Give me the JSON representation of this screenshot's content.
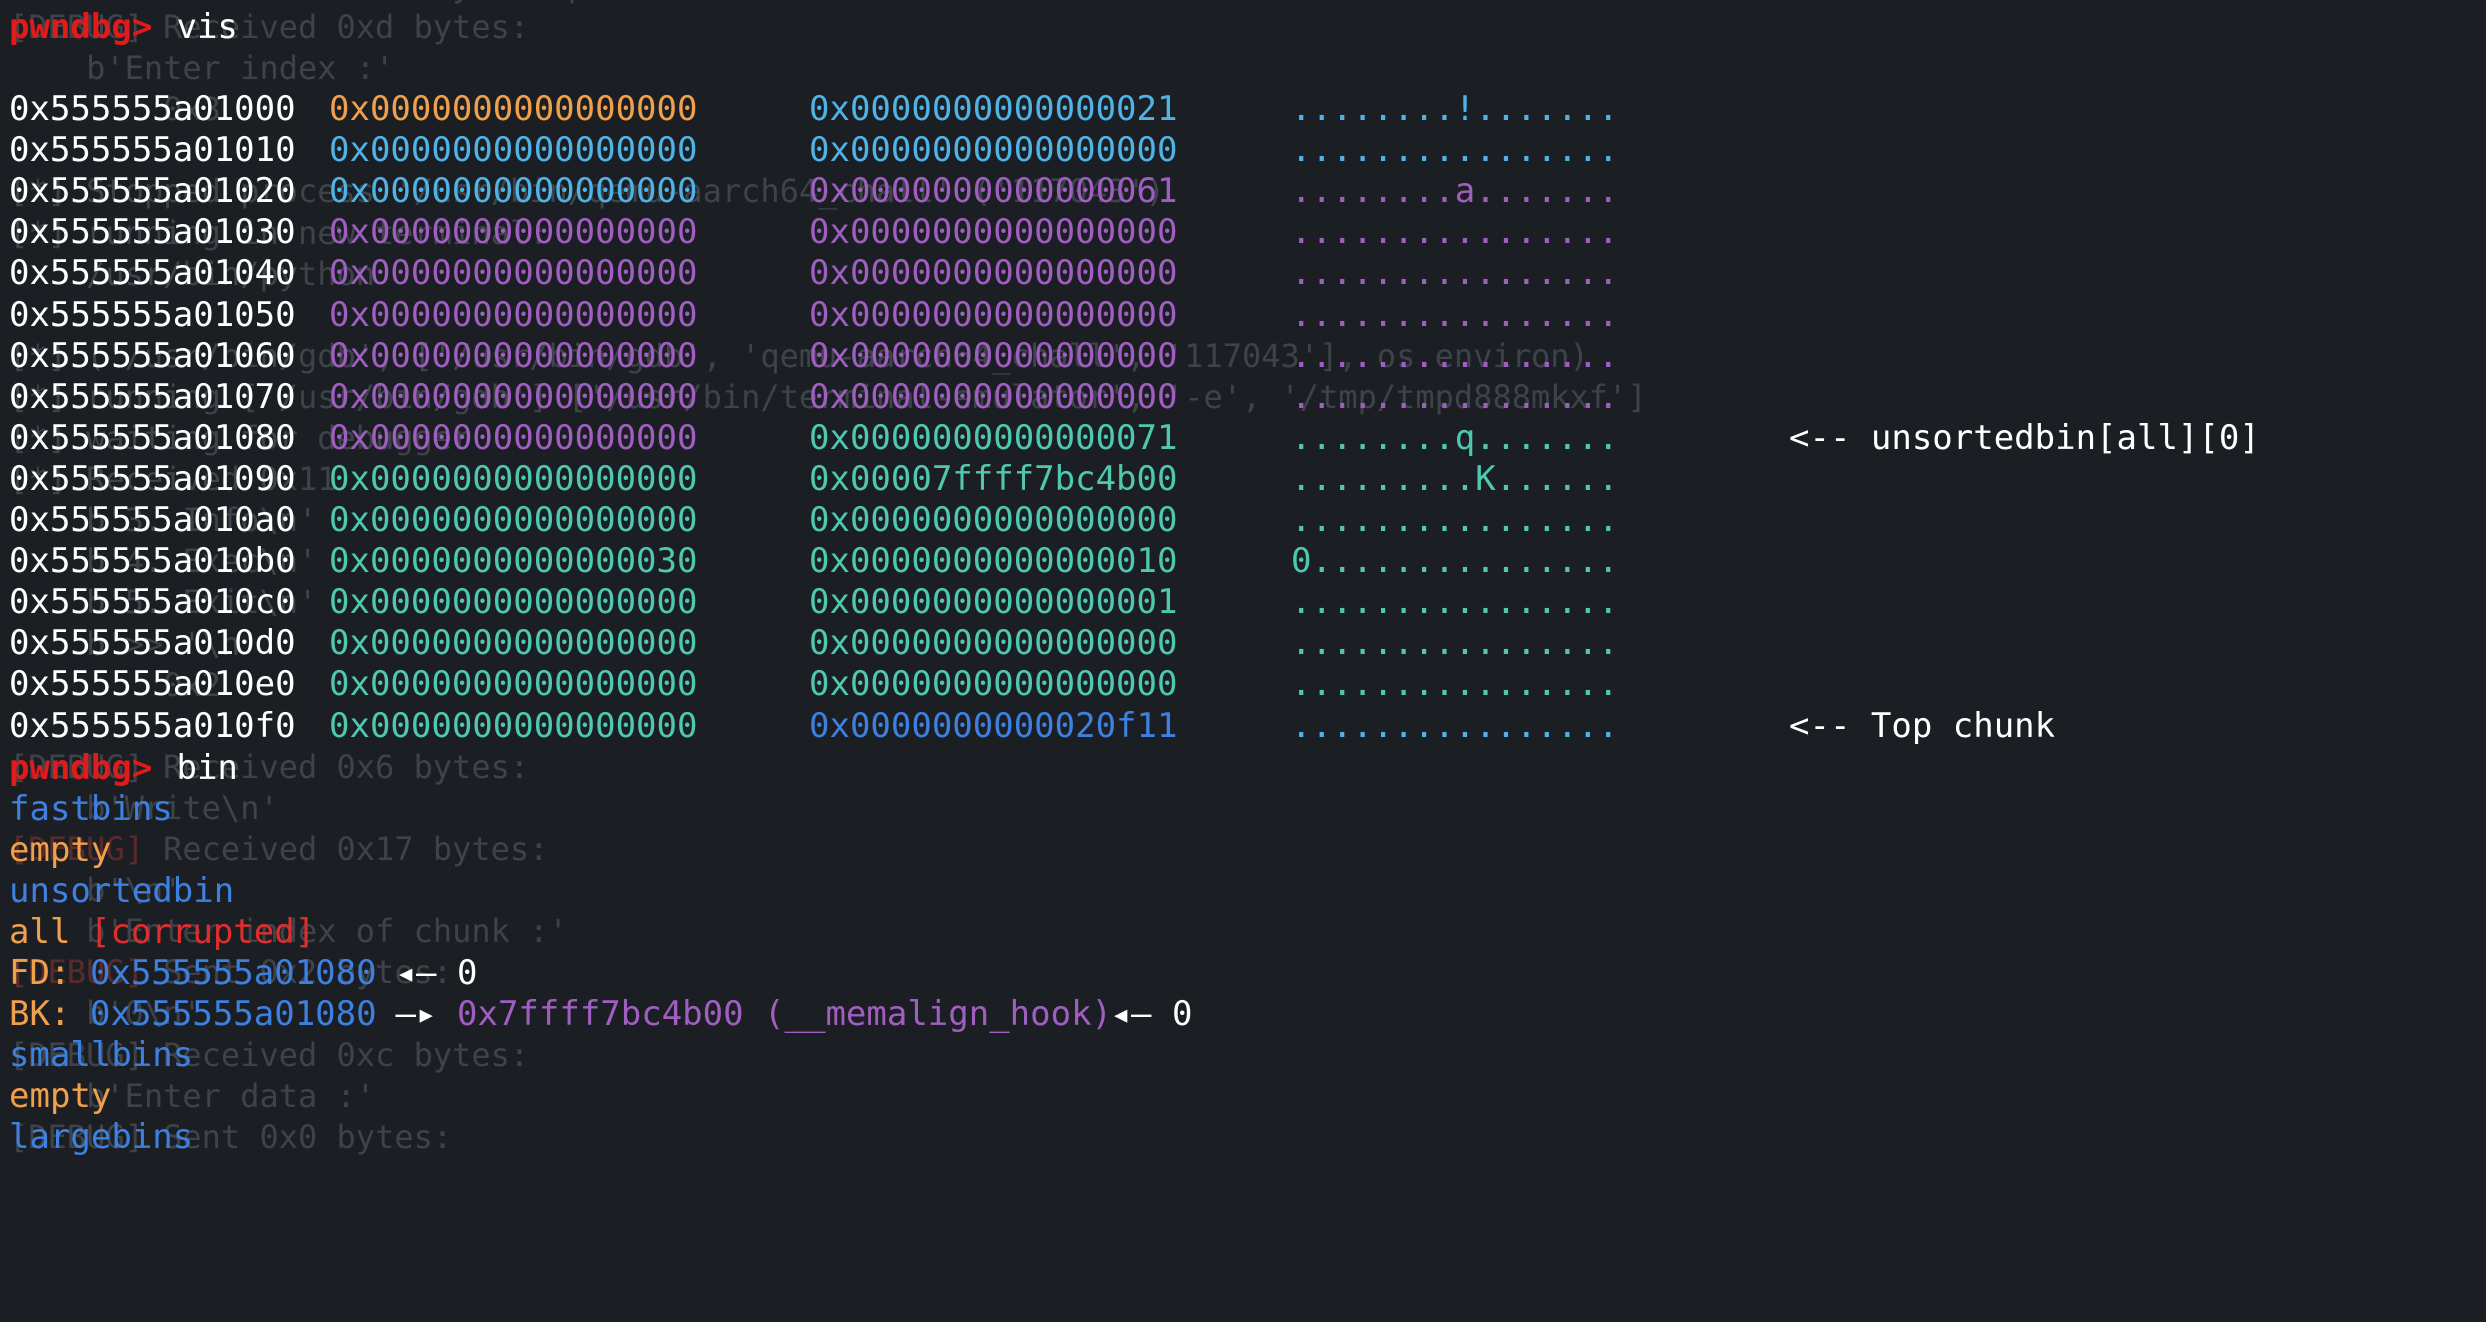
{
  "colors": {
    "background": "#1b1f24",
    "prompt": "#e01b1b",
    "address": "#ffffff",
    "orange": "#f0a04b",
    "sky": "#4fb3e6",
    "purple": "#a05fc0",
    "teal": "#4ec9b0",
    "blue": "#3d80e0",
    "ghost": "#3d4349"
  },
  "background_lines": [
    {
      "row": -1,
      "text": "                  ...ady ... p...",
      "red": false
    },
    {
      "row": 0,
      "text": "[DEBUG] Received 0xd bytes:",
      "red": false
    },
    {
      "row": 1,
      "text": "    b'Enter index :'",
      "red": false
    },
    {
      "row": 2,
      "text": "        0x3",
      "red": false
    },
    {
      "row": 4,
      "text": "[*] Stopped process '/usr/bin/qemu-aarch64_chall' ('117043')",
      "red": false
    },
    {
      "row": 5,
      "text": "[*] running in new terminal:",
      "red": false
    },
    {
      "row": 6,
      "text": "    /usr/bin/python",
      "red": false
    },
    {
      "row": 8,
      "text": "[*] ('/usr/bin/gdb', ['/usr/bin/gdb', 'qemu-aarch64_chall', '117043'], os.environ)",
      "red": false
    },
    {
      "row": 9,
      "text": "[*] running ['/usr/bin/gdb'] ['/usr/bin/terminal-emulator', '-e', '/tmp/tmpd888mkxf']",
      "red": false
    },
    {
      "row": 10,
      "text": "[*] waiting for debugger",
      "red": false
    },
    {
      "row": 11,
      "text": "[*] Received 0x11",
      "red": false
    },
    {
      "row": 12,
      "text": "    b'3. Info\\n'",
      "red": false
    },
    {
      "row": 13,
      "text": "    b'4. Exec\\n'",
      "red": false
    },
    {
      "row": 14,
      "text": "    b'5. Exit\\n'",
      "red": false
    },
    {
      "row": 15,
      "text": "    b'>> '\\n'",
      "red": false
    },
    {
      "row": 16,
      "text": "        0x2",
      "red": false
    },
    {
      "row": 18,
      "text": "[DEBUG] Received 0x6 bytes:",
      "red": false
    },
    {
      "row": 19,
      "text": "    b'Write\\n'",
      "red": false
    },
    {
      "row": 20,
      "text": "[DEBUG] Received 0x17 bytes:",
      "red": false
    },
    {
      "row": 20,
      "text": "[DEBUG]",
      "red": true
    },
    {
      "row": 21,
      "text": "    b'\\n'",
      "red": false
    },
    {
      "row": 22,
      "text": "    b'Enter index of chunk :'",
      "red": false
    },
    {
      "row": 23,
      "text": "[DEBUG] Sent 0x2 bytes:",
      "red": false
    },
    {
      "row": 23,
      "text": "[DEBUG]",
      "red": true
    },
    {
      "row": 24,
      "text": "    b'0\\n'",
      "red": false
    },
    {
      "row": 25,
      "text": "[DEBUG] Received 0xc bytes:",
      "red": false
    },
    {
      "row": 26,
      "text": "    b'Enter data :'",
      "red": false
    },
    {
      "row": 27,
      "text": "[DEBUG] Sent 0x0 bytes:",
      "red": false
    }
  ],
  "terminal": {
    "vis_prompt": {
      "prompt": "pwndbg>",
      "command": " vis"
    },
    "heap_rows": [
      {
        "addr": "0x555555a01000",
        "q1": "0x0000000000000000",
        "q1_color": "orange",
        "q2": "0x0000000000000021",
        "q2_color": "sky",
        "ascii": "........!.......",
        "ascii_color": "sky",
        "note": ""
      },
      {
        "addr": "0x555555a01010",
        "q1": "0x0000000000000000",
        "q1_color": "sky",
        "q2": "0x0000000000000000",
        "q2_color": "sky",
        "ascii": "................",
        "ascii_color": "sky",
        "note": ""
      },
      {
        "addr": "0x555555a01020",
        "q1": "0x0000000000000000",
        "q1_color": "sky",
        "q2": "0x0000000000000061",
        "q2_color": "purple",
        "ascii": "........a.......",
        "ascii_color": "purple",
        "note": ""
      },
      {
        "addr": "0x555555a01030",
        "q1": "0x0000000000000000",
        "q1_color": "purple",
        "q2": "0x0000000000000000",
        "q2_color": "purple",
        "ascii": "................",
        "ascii_color": "purple",
        "note": ""
      },
      {
        "addr": "0x555555a01040",
        "q1": "0x0000000000000000",
        "q1_color": "purple",
        "q2": "0x0000000000000000",
        "q2_color": "purple",
        "ascii": "................",
        "ascii_color": "purple",
        "note": ""
      },
      {
        "addr": "0x555555a01050",
        "q1": "0x0000000000000000",
        "q1_color": "purple",
        "q2": "0x0000000000000000",
        "q2_color": "purple",
        "ascii": "................",
        "ascii_color": "purple",
        "note": ""
      },
      {
        "addr": "0x555555a01060",
        "q1": "0x0000000000000000",
        "q1_color": "purple",
        "q2": "0x0000000000000000",
        "q2_color": "purple",
        "ascii": "................",
        "ascii_color": "purple",
        "note": ""
      },
      {
        "addr": "0x555555a01070",
        "q1": "0x0000000000000000",
        "q1_color": "purple",
        "q2": "0x0000000000000000",
        "q2_color": "purple",
        "ascii": "................",
        "ascii_color": "purple",
        "note": ""
      },
      {
        "addr": "0x555555a01080",
        "q1": "0x0000000000000000",
        "q1_color": "purple",
        "q2": "0x0000000000000071",
        "q2_color": "teal",
        "ascii": "........q.......",
        "ascii_color": "teal",
        "note": "<-- unsortedbin[all][0]"
      },
      {
        "addr": "0x555555a01090",
        "q1": "0x0000000000000000",
        "q1_color": "teal",
        "q2": "0x00007ffff7bc4b00",
        "q2_color": "teal",
        "ascii": ".........K......",
        "ascii_color": "teal",
        "note": ""
      },
      {
        "addr": "0x555555a010a0",
        "q1": "0x0000000000000000",
        "q1_color": "teal",
        "q2": "0x0000000000000000",
        "q2_color": "teal",
        "ascii": "................",
        "ascii_color": "teal",
        "note": ""
      },
      {
        "addr": "0x555555a010b0",
        "q1": "0x0000000000000030",
        "q1_color": "teal",
        "q2": "0x0000000000000010",
        "q2_color": "teal",
        "ascii": "0...............",
        "ascii_color": "teal",
        "note": ""
      },
      {
        "addr": "0x555555a010c0",
        "q1": "0x0000000000000000",
        "q1_color": "teal",
        "q2": "0x0000000000000001",
        "q2_color": "teal",
        "ascii": "................",
        "ascii_color": "teal",
        "note": ""
      },
      {
        "addr": "0x555555a010d0",
        "q1": "0x0000000000000000",
        "q1_color": "teal",
        "q2": "0x0000000000000000",
        "q2_color": "teal",
        "ascii": "................",
        "ascii_color": "teal",
        "note": ""
      },
      {
        "addr": "0x555555a010e0",
        "q1": "0x0000000000000000",
        "q1_color": "teal",
        "q2": "0x0000000000000000",
        "q2_color": "teal",
        "ascii": "................",
        "ascii_color": "teal",
        "note": ""
      },
      {
        "addr": "0x555555a010f0",
        "q1": "0x0000000000000000",
        "q1_color": "teal",
        "q2": "0x0000000000020f11",
        "q2_color": "blue",
        "ascii": "................",
        "ascii_color": "sky",
        "note": "<-- Top chunk"
      }
    ],
    "bin_prompt": {
      "prompt": "pwndbg>",
      "command": " bin"
    },
    "bins": {
      "fastbins_label": "fastbins",
      "fastbins_value": "empty",
      "unsortedbin_label": "unsortedbin",
      "all_label": "all ",
      "all_state": "[corrupted]",
      "fd_label": "FD: ",
      "fd_addr": "0x555555a01080",
      "fd_arrow": " ◂— ",
      "fd_value": "0",
      "bk_label": "BK: ",
      "bk_addr": "0x555555a01080",
      "bk_arrow": " —▸ ",
      "bk_target": "0x7ffff7bc4b00 (__memalign_hook)",
      "bk_arrow2": " ◂— ",
      "bk_value": "0",
      "smallbins_label": "smallbins",
      "smallbins_value": "empty",
      "largebins_label": "largebins"
    }
  }
}
